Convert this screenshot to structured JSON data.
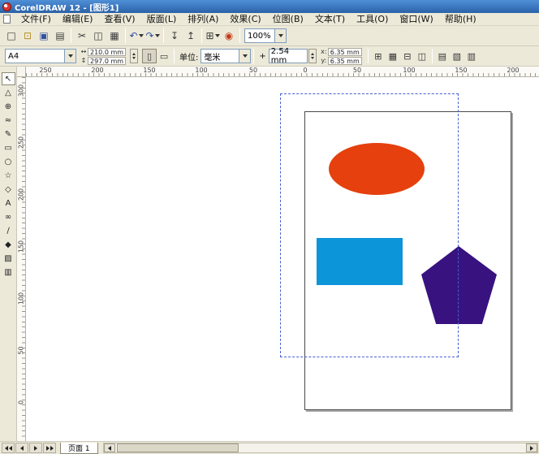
{
  "window": {
    "title": "CorelDRAW 12 - [图形1]"
  },
  "menu": {
    "items": [
      "文件(F)",
      "编辑(E)",
      "查看(V)",
      "版面(L)",
      "排列(A)",
      "效果(C)",
      "位图(B)",
      "文本(T)",
      "工具(O)",
      "窗口(W)",
      "帮助(H)"
    ]
  },
  "toolbar": {
    "buttons": [
      {
        "name": "new",
        "glyph": "□"
      },
      {
        "name": "open",
        "glyph": "⊡"
      },
      {
        "name": "save",
        "glyph": "▣"
      },
      {
        "name": "print",
        "glyph": "▤"
      },
      {
        "name": "cut",
        "glyph": "✂"
      },
      {
        "name": "copy",
        "glyph": "◫"
      },
      {
        "name": "paste",
        "glyph": "▦"
      },
      {
        "name": "undo",
        "glyph": "↶"
      },
      {
        "name": "redo",
        "glyph": "↷"
      },
      {
        "name": "import",
        "glyph": "↧"
      },
      {
        "name": "export",
        "glyph": "↥"
      },
      {
        "name": "app-launcher",
        "glyph": "⊞"
      },
      {
        "name": "corel-online",
        "glyph": "◉"
      }
    ],
    "zoom_value": "100%"
  },
  "property_bar": {
    "paper_size": "A4",
    "paper_width": "210.0 mm",
    "paper_height": "297.0 mm",
    "width_icon": "↔",
    "height_icon": "↕",
    "portrait_icon": "▯",
    "landscape_icon": "▭",
    "units_label": "单位:",
    "units_value": "毫米",
    "nudge_icon": "+",
    "nudge_value": "2.54 mm",
    "dup_x_label": "x:",
    "dup_x_value": "6.35 mm",
    "dup_y_label": "y:",
    "dup_y_value": "6.35 mm",
    "snap_buttons": [
      {
        "name": "snap-to-grid",
        "glyph": "⊞"
      },
      {
        "name": "snap-to-guidelines",
        "glyph": "▦"
      },
      {
        "name": "snap-to-objects",
        "glyph": "⊟"
      },
      {
        "name": "dynamic-guides",
        "glyph": "◫"
      },
      {
        "name": "treat-as-filled",
        "glyph": "▤"
      },
      {
        "name": "show-page-border",
        "glyph": "▧"
      },
      {
        "name": "draw-options",
        "glyph": "▥"
      }
    ]
  },
  "rulers": {
    "h_labels": [
      "250",
      "200",
      "150",
      "100",
      "50",
      "0",
      "50",
      "100",
      "150",
      "200"
    ],
    "v_labels": [
      "300",
      "250",
      "200",
      "150",
      "100",
      "50",
      "0"
    ]
  },
  "toolbox": {
    "tools": [
      {
        "name": "pick-tool",
        "glyph": "↖"
      },
      {
        "name": "shape-tool",
        "glyph": "△"
      },
      {
        "name": "zoom-tool",
        "glyph": "⊕"
      },
      {
        "name": "freehand-tool",
        "glyph": "≈"
      },
      {
        "name": "smart-drawing-tool",
        "glyph": "✎"
      },
      {
        "name": "rectangle-tool",
        "glyph": "▭"
      },
      {
        "name": "ellipse-tool",
        "glyph": "○"
      },
      {
        "name": "polygon-tool",
        "glyph": "☆"
      },
      {
        "name": "basic-shapes-tool",
        "glyph": "◇"
      },
      {
        "name": "text-tool",
        "glyph": "A"
      },
      {
        "name": "interactive-blend-tool",
        "glyph": "∞"
      },
      {
        "name": "eyedropper-tool",
        "glyph": "∕"
      },
      {
        "name": "outline-tool",
        "glyph": "◆"
      },
      {
        "name": "fill-tool",
        "glyph": "▨"
      },
      {
        "name": "interactive-fill-tool",
        "glyph": "▥"
      }
    ]
  },
  "canvas": {
    "selection_color": "#4a5fd0",
    "shapes": {
      "ellipse_color": "#e5400d",
      "rectangle_color": "#0d95d9",
      "pentagon_color": "#38127f"
    }
  },
  "page_bar": {
    "tab_label": "页面 1"
  }
}
